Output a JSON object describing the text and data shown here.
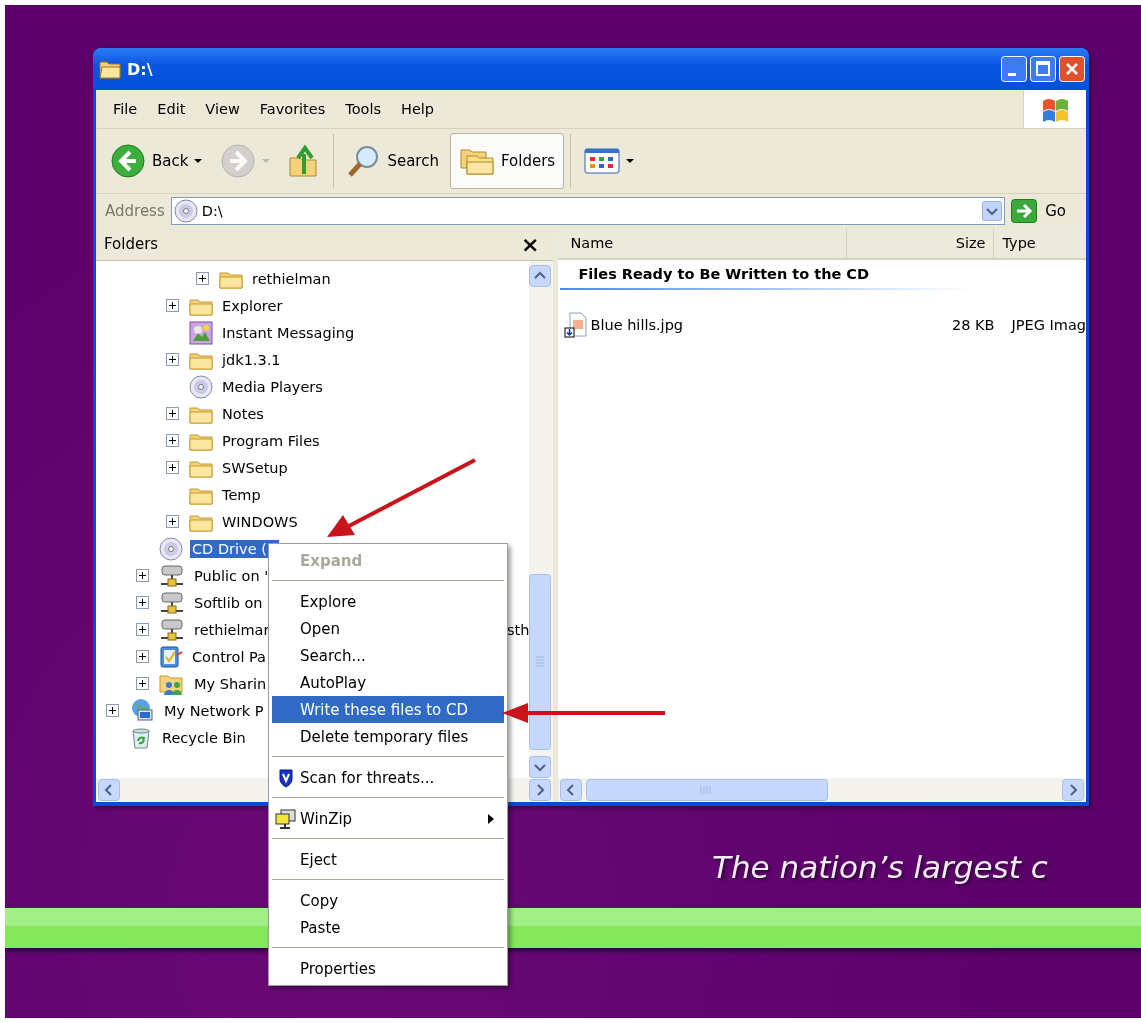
{
  "wallpaper": {
    "tagline": "The nation’s largest c"
  },
  "window": {
    "title": "D:\\"
  },
  "menu_bar": [
    "File",
    "Edit",
    "View",
    "Favorites",
    "Tools",
    "Help"
  ],
  "toolbar": {
    "groups": [
      [
        {
          "kind": "back",
          "label": "Back",
          "disabled": false,
          "selected": false
        },
        {
          "kind": "forward",
          "disabled": true,
          "selected": false
        },
        {
          "kind": "up",
          "disabled": false,
          "selected": false
        }
      ],
      [
        {
          "kind": "search",
          "label": "Search",
          "disabled": false,
          "selected": false
        },
        {
          "kind": "folders",
          "label": "Folders",
          "disabled": false,
          "selected": true
        }
      ],
      [
        {
          "kind": "views",
          "disabled": false,
          "selected": false
        }
      ]
    ]
  },
  "address": {
    "label": "Address",
    "value": "D:\\",
    "go": "Go"
  },
  "folders_pane": {
    "title": "Folders",
    "close": "×",
    "tree": [
      {
        "children": [
          {
            "children": [
              {
                "children": [
                  {
                    "label": "rethielman",
                    "kind": "folder",
                    "expandable": true,
                    "selected": false
                  }
                ]
              },
              {
                "label": "Explorer",
                "kind": "folder",
                "expandable": true,
                "selected": false
              },
              {
                "label": "Instant Messaging",
                "kind": "messenger",
                "expandable": false,
                "selected": false
              },
              {
                "label": "jdk1.3.1",
                "kind": "folder",
                "expandable": true,
                "selected": false
              },
              {
                "label": "Media Players",
                "kind": "cd",
                "expandable": false,
                "selected": false
              },
              {
                "label": "Notes",
                "kind": "folder",
                "expandable": true,
                "selected": false
              },
              {
                "label": "Program Files",
                "kind": "folder",
                "expandable": true,
                "selected": false
              },
              {
                "label": "SWSetup",
                "kind": "folder",
                "expandable": true,
                "selected": false
              },
              {
                "label": "Temp",
                "kind": "folder",
                "expandable": false,
                "selected": false
              },
              {
                "label": "WINDOWS",
                "kind": "folder",
                "expandable": true,
                "selected": false
              }
            ]
          },
          {
            "label": "CD Drive (",
            "kind": "cd",
            "expandable": false,
            "selected": true
          },
          {
            "label": "Public on '",
            "kind": "network-drive",
            "expandable": true,
            "selected": false
          },
          {
            "label": "Softlib on",
            "kind": "network-drive",
            "expandable": true,
            "selected": false
          },
          {
            "label": "rethielmar",
            "tail": "sth",
            "kind": "network-drive",
            "expandable": true,
            "selected": false
          },
          {
            "label": "Control Pa",
            "kind": "control-panel",
            "expandable": true,
            "selected": false
          },
          {
            "label": "My Sharin",
            "kind": "shared",
            "expandable": true,
            "selected": false
          }
        ]
      },
      {
        "label": "My Network P",
        "kind": "network",
        "expandable": true,
        "selected": false
      },
      {
        "label": "Recycle Bin",
        "kind": "recycle",
        "expandable": false,
        "selected": false
      }
    ]
  },
  "files": {
    "columns": [
      "Name",
      "Size",
      "Type"
    ],
    "group": "Files Ready to Be Written to the CD",
    "rows": [
      {
        "name": "Blue hills.jpg",
        "size": "28 KB",
        "type": "JPEG Imag"
      }
    ]
  },
  "context_menu": [
    {
      "kind": "item",
      "label": "Expand",
      "default": true,
      "disabled": true,
      "selected": false
    },
    {
      "kind": "separator"
    },
    {
      "kind": "item",
      "label": "Explore",
      "default": false,
      "disabled": false,
      "selected": false
    },
    {
      "kind": "item",
      "label": "Open",
      "default": false,
      "disabled": false,
      "selected": false
    },
    {
      "kind": "item",
      "label": "Search...",
      "default": false,
      "disabled": false,
      "selected": false
    },
    {
      "kind": "item",
      "label": "AutoPlay",
      "default": false,
      "disabled": false,
      "selected": false
    },
    {
      "kind": "item",
      "label": "Write these files to CD",
      "default": false,
      "disabled": false,
      "selected": true
    },
    {
      "kind": "item",
      "label": "Delete temporary files",
      "default": false,
      "disabled": false,
      "selected": false
    },
    {
      "kind": "separator"
    },
    {
      "kind": "shield",
      "label": "Scan for threats...",
      "default": false,
      "disabled": false,
      "selected": false
    },
    {
      "kind": "separator"
    },
    {
      "kind": "winzip",
      "label": "WinZip",
      "submenu": true,
      "default": false,
      "disabled": false,
      "selected": false
    },
    {
      "kind": "separator"
    },
    {
      "kind": "item",
      "label": "Eject",
      "default": false,
      "disabled": false,
      "selected": false
    },
    {
      "kind": "separator"
    },
    {
      "kind": "item",
      "label": "Copy",
      "default": false,
      "disabled": false,
      "selected": false
    },
    {
      "kind": "item",
      "label": "Paste",
      "default": false,
      "disabled": false,
      "selected": false
    },
    {
      "kind": "separator"
    },
    {
      "kind": "item",
      "label": "Properties",
      "default": false,
      "disabled": false,
      "selected": false
    }
  ]
}
